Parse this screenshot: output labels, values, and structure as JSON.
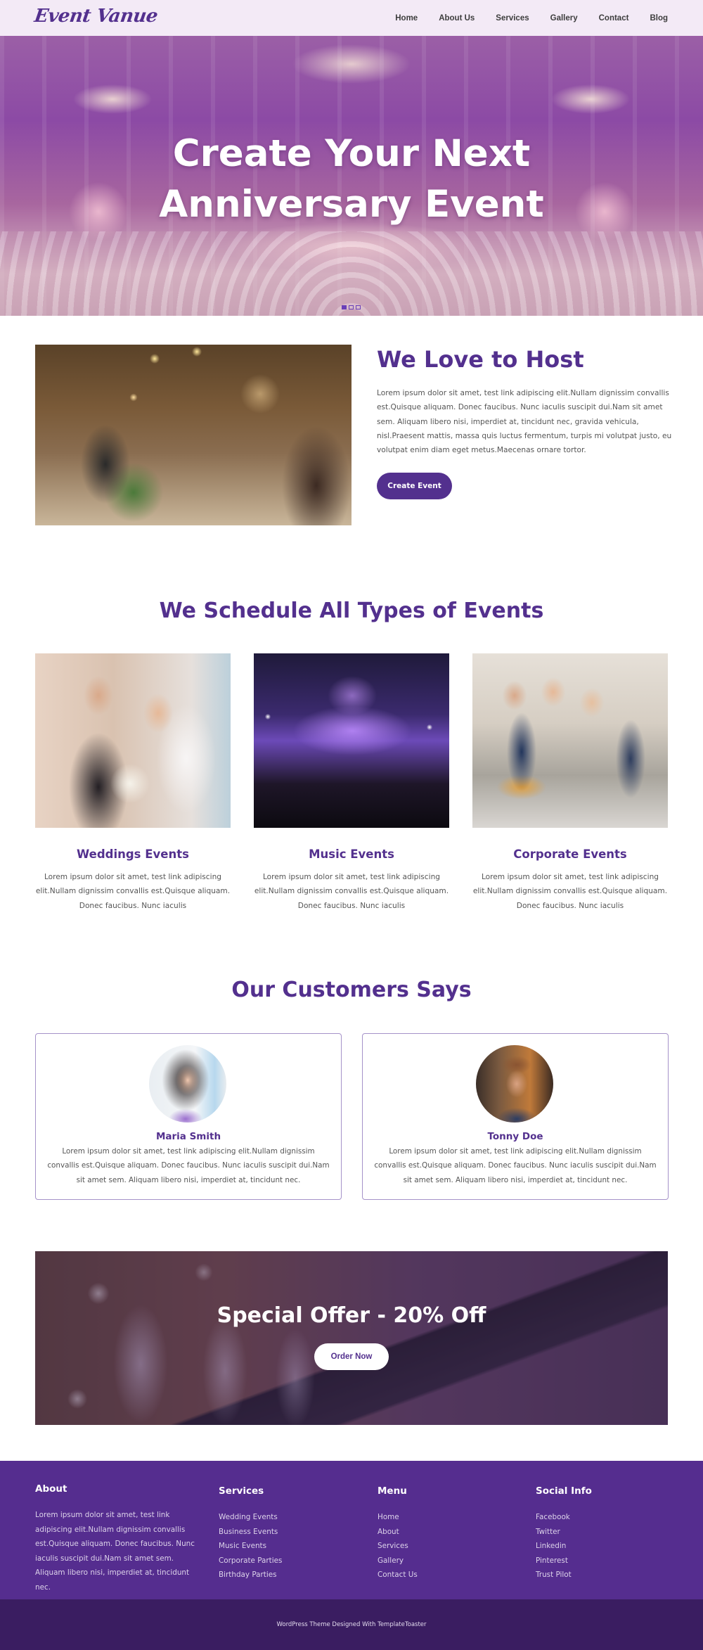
{
  "header": {
    "logo": "Event Vanue",
    "nav": [
      "Home",
      "About Us",
      "Services",
      "Gallery",
      "Contact",
      "Blog"
    ]
  },
  "hero": {
    "title_line1": "Create Your Next",
    "title_line2": "Anniversary Event",
    "slides": 3,
    "active_slide": 1
  },
  "host": {
    "title": "We Love to Host",
    "text": "Lorem ipsum dolor sit amet, test link adipiscing elit.Nullam dignissim convallis est.Quisque aliquam. Donec faucibus. Nunc iaculis suscipit dui.Nam sit amet sem. Aliquam libero nisi, imperdiet at, tincidunt nec, gravida vehicula, nisl.Praesent mattis, massa quis luctus fermentum, turpis mi volutpat justo, eu volutpat enim diam eget metus.Maecenas ornare tortor.",
    "button": "Create Event"
  },
  "schedule": {
    "title": "We Schedule All Types of Events",
    "events": [
      {
        "title": "Weddings Events",
        "text": "Lorem ipsum dolor sit amet, test link adipiscing elit.Nullam dignissim convallis est.Quisque aliquam. Donec faucibus. Nunc iaculis"
      },
      {
        "title": "Music Events",
        "text": "Lorem ipsum dolor sit amet, test link adipiscing elit.Nullam dignissim convallis est.Quisque aliquam. Donec faucibus. Nunc iaculis"
      },
      {
        "title": "Corporate Events",
        "text": "Lorem ipsum dolor sit amet, test link adipiscing elit.Nullam dignissim convallis est.Quisque aliquam. Donec faucibus. Nunc iaculis"
      }
    ]
  },
  "testimonials": {
    "title": "Our Customers Says",
    "items": [
      {
        "name": "Maria Smith",
        "text": "Lorem ipsum dolor sit amet, test link adipiscing elit.Nullam dignissim convallis est.Quisque aliquam. Donec faucibus. Nunc iaculis suscipit dui.Nam sit amet sem. Aliquam libero nisi, imperdiet at, tincidunt nec."
      },
      {
        "name": "Tonny Doe",
        "text": "Lorem ipsum dolor sit amet, test link adipiscing elit.Nullam dignissim convallis est.Quisque aliquam. Donec faucibus. Nunc iaculis suscipit dui.Nam sit amet sem. Aliquam libero nisi, imperdiet at, tincidunt nec."
      }
    ]
  },
  "offer": {
    "title": "Special Offer - 20% Off",
    "button": "Order Now"
  },
  "footer": {
    "about": {
      "title": "About",
      "text": "Lorem ipsum dolor sit amet, test link adipiscing elit.Nullam dignissim convallis est.Quisque aliquam. Donec faucibus. Nunc iaculis suscipit dui.Nam sit amet sem. Aliquam libero nisi, imperdiet at, tincidunt nec."
    },
    "services": {
      "title": "Services",
      "items": [
        "Wedding Events",
        "Business Events",
        "Music Events",
        "Corporate Parties",
        "Birthday Parties"
      ]
    },
    "menu": {
      "title": "Menu",
      "items": [
        "Home",
        "About",
        "Services",
        "Gallery",
        "Contact Us"
      ]
    },
    "social": {
      "title": "Social Info",
      "items": [
        "Facebook",
        "Twitter",
        "Linkedin",
        "Pinterest",
        "Trust Pilot"
      ]
    },
    "copyright": "WordPress Theme Designed With TemplateToaster"
  },
  "colors": {
    "brand": "#53308e",
    "header_bg": "#f3eaf6",
    "footer_bg": "#552d8f",
    "copyright_bg": "#3a1d61"
  }
}
